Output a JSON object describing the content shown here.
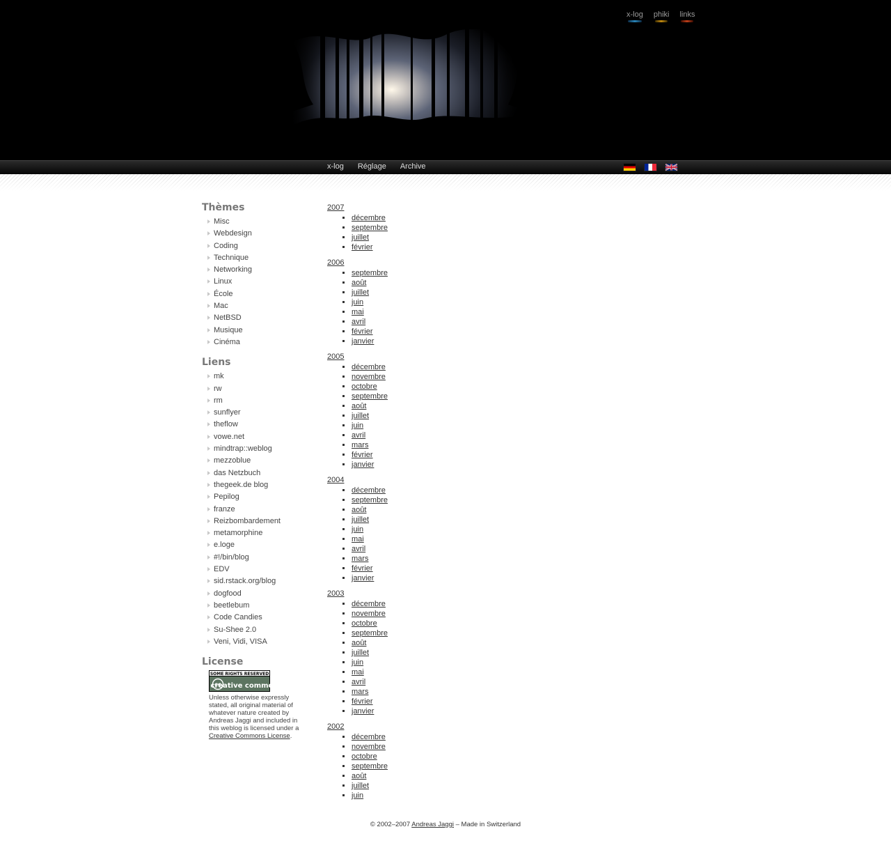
{
  "top_links": [
    "x-log",
    "phiki",
    "links"
  ],
  "main_nav": [
    "x-log",
    "Réglage",
    "Archive"
  ],
  "languages": [
    "de",
    "fr",
    "en"
  ],
  "sidebar": {
    "themes_heading": "Thèmes",
    "themes": [
      "Misc",
      "Webdesign",
      "Coding",
      "Technique",
      "Networking",
      "Linux",
      "École",
      "Mac",
      "NetBSD",
      "Musique",
      "Cinéma"
    ],
    "links_heading": "Liens",
    "links": [
      "mk",
      "rw",
      "rm",
      "sunflyer",
      "theflow",
      "vowe.net",
      "mindtrap::weblog",
      "mezzoblue",
      "das Netzbuch",
      "thegeek.de blog",
      "Pepilog",
      "franze",
      "Reizbombardement",
      "metamorphine",
      "e.loge",
      "#!/bin/blog",
      "EDV",
      "sid.rstack.org/blog",
      "dogfood",
      "beetlebum",
      "Code Candies",
      "Su-Shee 2.0",
      "Veni, Vidi, VISA"
    ],
    "license_heading": "License",
    "license_badge_top": "SOME RIGHTS RESERVED",
    "license_badge_text": "creative commons",
    "license_text_before": "Unless otherwise expressly stated, all original material of whatever nature created by Andreas Jaggi and included in this weblog is licensed under a ",
    "license_link": "Creative Commons License",
    "license_text_after": "."
  },
  "archive": [
    {
      "year": "2007",
      "months": [
        "décembre",
        "septembre",
        "juillet",
        "février"
      ]
    },
    {
      "year": "2006",
      "months": [
        "septembre",
        "août",
        "juillet",
        "juin",
        "mai",
        "avril",
        "février",
        "janvier"
      ]
    },
    {
      "year": "2005",
      "months": [
        "décembre",
        "novembre",
        "octobre",
        "septembre",
        "août",
        "juillet",
        "juin",
        "avril",
        "mars",
        "février",
        "janvier"
      ]
    },
    {
      "year": "2004",
      "months": [
        "décembre",
        "septembre",
        "août",
        "juillet",
        "juin",
        "mai",
        "avril",
        "mars",
        "février",
        "janvier"
      ]
    },
    {
      "year": "2003",
      "months": [
        "décembre",
        "novembre",
        "octobre",
        "septembre",
        "août",
        "juillet",
        "juin",
        "mai",
        "avril",
        "mars",
        "février",
        "janvier"
      ]
    },
    {
      "year": "2002",
      "months": [
        "décembre",
        "novembre",
        "octobre",
        "septembre",
        "août",
        "juillet",
        "juin"
      ]
    }
  ],
  "footer": {
    "before": "© 2002–2007 ",
    "author": "Andreas Jaggi",
    "after": " – Made in Switzerland"
  }
}
